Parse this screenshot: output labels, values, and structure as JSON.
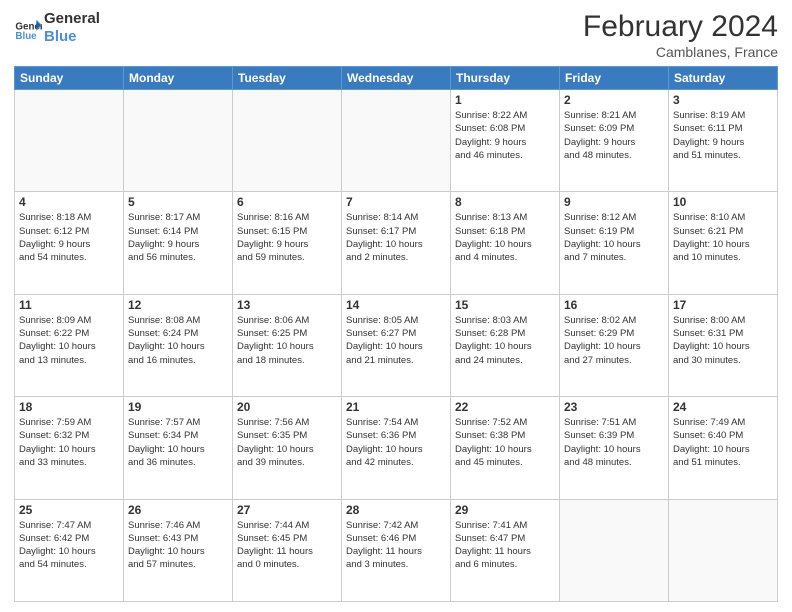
{
  "header": {
    "logo_line1": "General",
    "logo_line2": "Blue",
    "title": "February 2024",
    "location": "Camblanes, France"
  },
  "days_of_week": [
    "Sunday",
    "Monday",
    "Tuesday",
    "Wednesday",
    "Thursday",
    "Friday",
    "Saturday"
  ],
  "weeks": [
    [
      {
        "day": "",
        "info": ""
      },
      {
        "day": "",
        "info": ""
      },
      {
        "day": "",
        "info": ""
      },
      {
        "day": "",
        "info": ""
      },
      {
        "day": "1",
        "info": "Sunrise: 8:22 AM\nSunset: 6:08 PM\nDaylight: 9 hours\nand 46 minutes."
      },
      {
        "day": "2",
        "info": "Sunrise: 8:21 AM\nSunset: 6:09 PM\nDaylight: 9 hours\nand 48 minutes."
      },
      {
        "day": "3",
        "info": "Sunrise: 8:19 AM\nSunset: 6:11 PM\nDaylight: 9 hours\nand 51 minutes."
      }
    ],
    [
      {
        "day": "4",
        "info": "Sunrise: 8:18 AM\nSunset: 6:12 PM\nDaylight: 9 hours\nand 54 minutes."
      },
      {
        "day": "5",
        "info": "Sunrise: 8:17 AM\nSunset: 6:14 PM\nDaylight: 9 hours\nand 56 minutes."
      },
      {
        "day": "6",
        "info": "Sunrise: 8:16 AM\nSunset: 6:15 PM\nDaylight: 9 hours\nand 59 minutes."
      },
      {
        "day": "7",
        "info": "Sunrise: 8:14 AM\nSunset: 6:17 PM\nDaylight: 10 hours\nand 2 minutes."
      },
      {
        "day": "8",
        "info": "Sunrise: 8:13 AM\nSunset: 6:18 PM\nDaylight: 10 hours\nand 4 minutes."
      },
      {
        "day": "9",
        "info": "Sunrise: 8:12 AM\nSunset: 6:19 PM\nDaylight: 10 hours\nand 7 minutes."
      },
      {
        "day": "10",
        "info": "Sunrise: 8:10 AM\nSunset: 6:21 PM\nDaylight: 10 hours\nand 10 minutes."
      }
    ],
    [
      {
        "day": "11",
        "info": "Sunrise: 8:09 AM\nSunset: 6:22 PM\nDaylight: 10 hours\nand 13 minutes."
      },
      {
        "day": "12",
        "info": "Sunrise: 8:08 AM\nSunset: 6:24 PM\nDaylight: 10 hours\nand 16 minutes."
      },
      {
        "day": "13",
        "info": "Sunrise: 8:06 AM\nSunset: 6:25 PM\nDaylight: 10 hours\nand 18 minutes."
      },
      {
        "day": "14",
        "info": "Sunrise: 8:05 AM\nSunset: 6:27 PM\nDaylight: 10 hours\nand 21 minutes."
      },
      {
        "day": "15",
        "info": "Sunrise: 8:03 AM\nSunset: 6:28 PM\nDaylight: 10 hours\nand 24 minutes."
      },
      {
        "day": "16",
        "info": "Sunrise: 8:02 AM\nSunset: 6:29 PM\nDaylight: 10 hours\nand 27 minutes."
      },
      {
        "day": "17",
        "info": "Sunrise: 8:00 AM\nSunset: 6:31 PM\nDaylight: 10 hours\nand 30 minutes."
      }
    ],
    [
      {
        "day": "18",
        "info": "Sunrise: 7:59 AM\nSunset: 6:32 PM\nDaylight: 10 hours\nand 33 minutes."
      },
      {
        "day": "19",
        "info": "Sunrise: 7:57 AM\nSunset: 6:34 PM\nDaylight: 10 hours\nand 36 minutes."
      },
      {
        "day": "20",
        "info": "Sunrise: 7:56 AM\nSunset: 6:35 PM\nDaylight: 10 hours\nand 39 minutes."
      },
      {
        "day": "21",
        "info": "Sunrise: 7:54 AM\nSunset: 6:36 PM\nDaylight: 10 hours\nand 42 minutes."
      },
      {
        "day": "22",
        "info": "Sunrise: 7:52 AM\nSunset: 6:38 PM\nDaylight: 10 hours\nand 45 minutes."
      },
      {
        "day": "23",
        "info": "Sunrise: 7:51 AM\nSunset: 6:39 PM\nDaylight: 10 hours\nand 48 minutes."
      },
      {
        "day": "24",
        "info": "Sunrise: 7:49 AM\nSunset: 6:40 PM\nDaylight: 10 hours\nand 51 minutes."
      }
    ],
    [
      {
        "day": "25",
        "info": "Sunrise: 7:47 AM\nSunset: 6:42 PM\nDaylight: 10 hours\nand 54 minutes."
      },
      {
        "day": "26",
        "info": "Sunrise: 7:46 AM\nSunset: 6:43 PM\nDaylight: 10 hours\nand 57 minutes."
      },
      {
        "day": "27",
        "info": "Sunrise: 7:44 AM\nSunset: 6:45 PM\nDaylight: 11 hours\nand 0 minutes."
      },
      {
        "day": "28",
        "info": "Sunrise: 7:42 AM\nSunset: 6:46 PM\nDaylight: 11 hours\nand 3 minutes."
      },
      {
        "day": "29",
        "info": "Sunrise: 7:41 AM\nSunset: 6:47 PM\nDaylight: 11 hours\nand 6 minutes."
      },
      {
        "day": "",
        "info": ""
      },
      {
        "day": "",
        "info": ""
      }
    ]
  ]
}
